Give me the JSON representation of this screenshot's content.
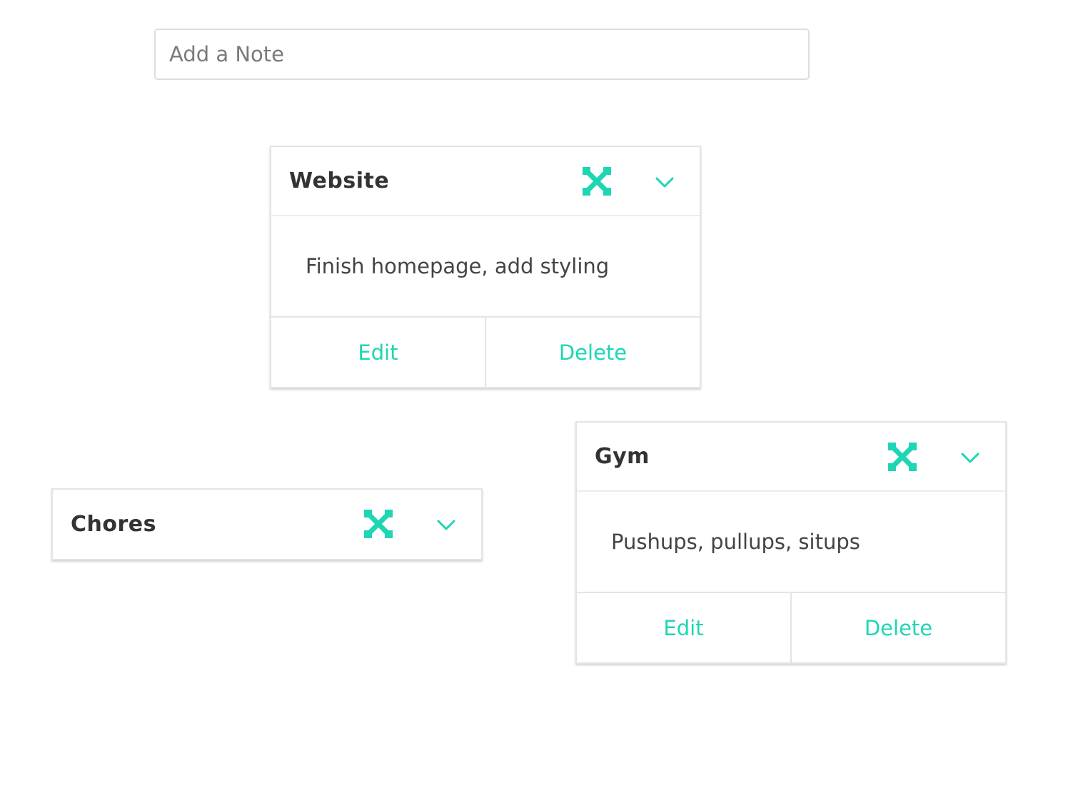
{
  "add_note": {
    "placeholder": "Add a Note",
    "value": ""
  },
  "colors": {
    "accent": "#1ed6b4",
    "text_dark": "#333333",
    "border": "#e4e4e4"
  },
  "icons": {
    "expand": "expand-arrows-icon",
    "collapse_toggle": "chevron-down-icon"
  },
  "notes": [
    {
      "title": "Website",
      "body": "Finish homepage, add styling",
      "expanded": true,
      "edit_label": "Edit",
      "delete_label": "Delete"
    },
    {
      "title": "Gym",
      "body": "Pushups, pullups, situps",
      "expanded": true,
      "edit_label": "Edit",
      "delete_label": "Delete"
    },
    {
      "title": "Chores",
      "expanded": false
    }
  ]
}
